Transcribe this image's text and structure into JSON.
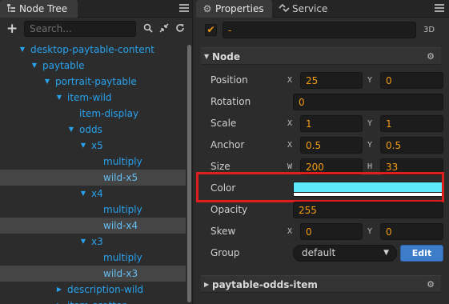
{
  "node_tree": {
    "tab_title": "Node Tree",
    "search_placeholder": "Search...",
    "rows": [
      {
        "label": "desktop-paytable-content",
        "expanded": true
      },
      {
        "label": "paytable",
        "expanded": true
      },
      {
        "label": "portrait-paytable",
        "expanded": true
      },
      {
        "label": "item-wild",
        "expanded": true
      },
      {
        "label": "item-display"
      },
      {
        "label": "odds",
        "expanded": true
      },
      {
        "label": "x5",
        "expanded": true
      },
      {
        "label": "multiply"
      },
      {
        "label": "wild-x5",
        "highlighted": true
      },
      {
        "label": "x4",
        "expanded": true
      },
      {
        "label": "multiply"
      },
      {
        "label": "wild-x4",
        "highlighted": true
      },
      {
        "label": "x3",
        "expanded": true
      },
      {
        "label": "multiply"
      },
      {
        "label": "wild-x3",
        "highlighted": true
      },
      {
        "label": "description-wild",
        "expanded": false
      },
      {
        "label": "item-scatter",
        "expanded": false
      }
    ]
  },
  "properties": {
    "tab_title": "Properties",
    "service_tab": "Service",
    "node_name": "-",
    "node_enabled": true,
    "mode_tag": "3D",
    "node_section": "Node",
    "position": {
      "label": "Position",
      "x_axis": "X",
      "x": "25",
      "y_axis": "Y",
      "y": "0"
    },
    "rotation": {
      "label": "Rotation",
      "value": "0"
    },
    "scale": {
      "label": "Scale",
      "x_axis": "X",
      "x": "1",
      "y_axis": "Y",
      "y": "1"
    },
    "anchor": {
      "label": "Anchor",
      "x_axis": "X",
      "x": "0.5",
      "y_axis": "Y",
      "y": "0.5"
    },
    "size": {
      "label": "Size",
      "w_axis": "W",
      "w": "200",
      "h_axis": "H",
      "h": "33"
    },
    "color": {
      "label": "Color",
      "value": "#5ce9fb",
      "alpha_bar": "#ffffff"
    },
    "opacity": {
      "label": "Opacity",
      "value": "255"
    },
    "skew": {
      "label": "Skew",
      "x_axis": "X",
      "x": "0",
      "y_axis": "Y",
      "y": "0"
    },
    "group": {
      "label": "Group",
      "value": "default",
      "edit_label": "Edit"
    },
    "component_section": "paytable-odds-item"
  },
  "colors": {
    "accent_blue": "#28a2ee",
    "value_orange": "#f39c12",
    "highlight_red": "#e01e1e",
    "button_blue": "#3d7cc9"
  }
}
